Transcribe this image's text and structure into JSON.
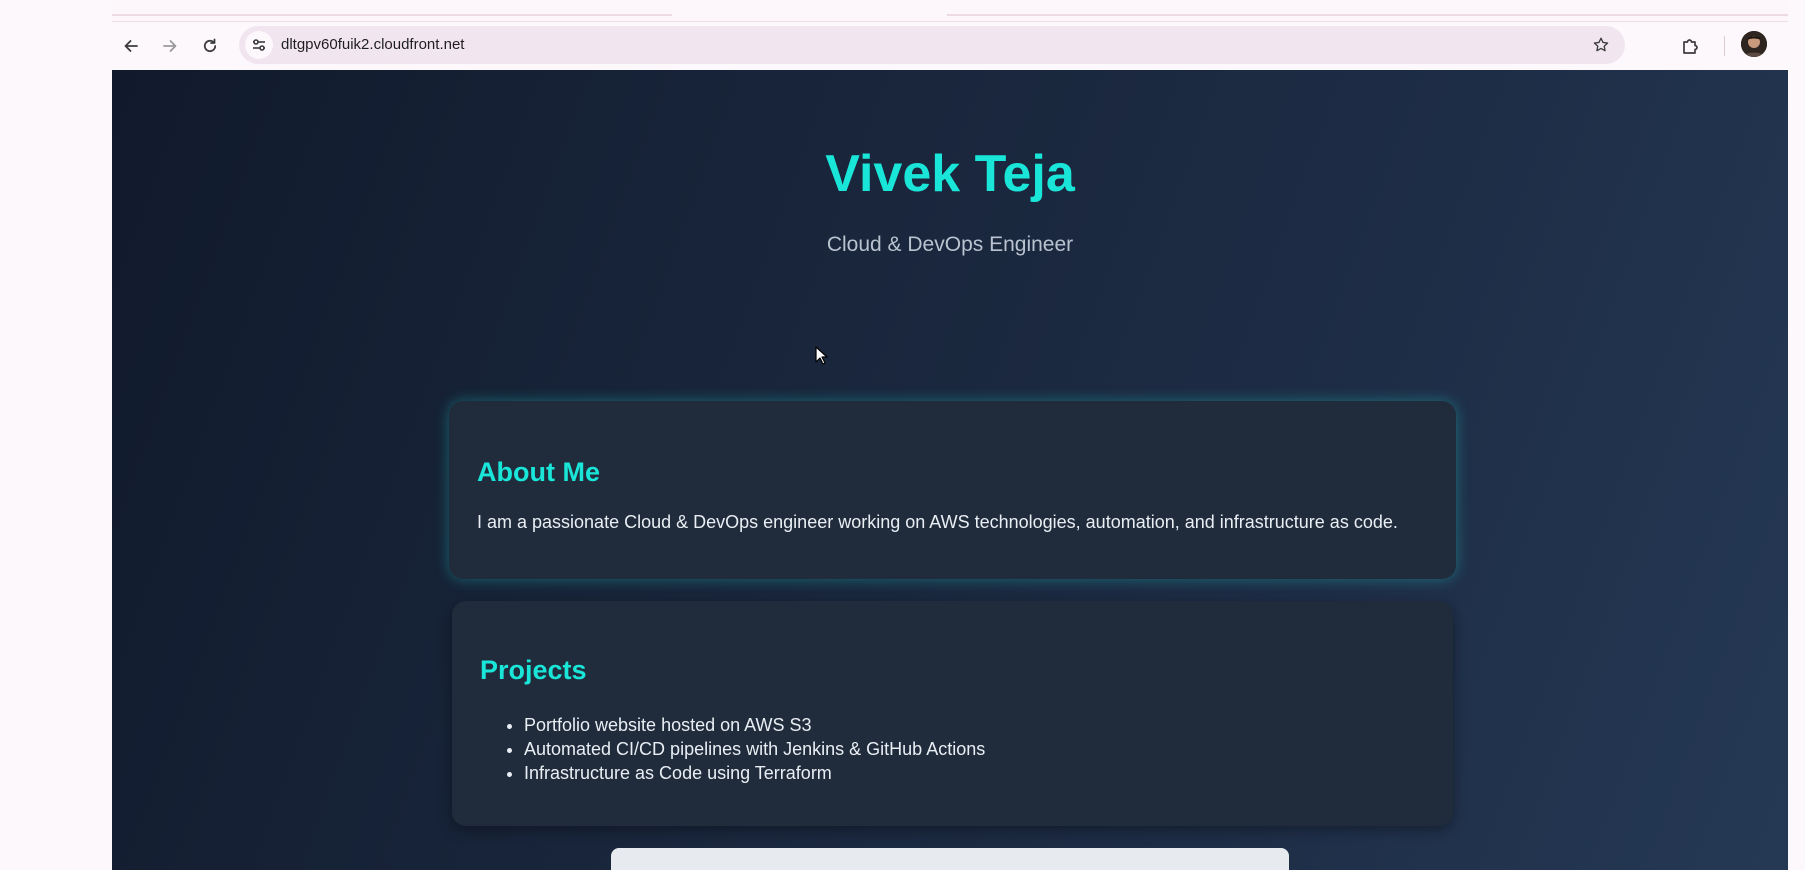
{
  "browser": {
    "url": "dltgpv60fuik2.cloudfront.net",
    "icons": {
      "back": "arrow-left-icon",
      "forward": "arrow-right-icon",
      "reload": "reload-icon",
      "site_info": "tune-icon",
      "bookmark": "star-icon",
      "extensions": "puzzle-icon",
      "profile": "avatar-icon"
    }
  },
  "hero": {
    "name": "Vivek Teja",
    "subtitle": "Cloud & DevOps Engineer"
  },
  "about": {
    "heading": "About Me",
    "text": "I am a passionate Cloud & DevOps engineer working on AWS technologies, automation, and infrastructure as code."
  },
  "projects": {
    "heading": "Projects",
    "items": [
      "Portfolio website hosted on AWS S3",
      "Automated CI/CD pipelines with Jenkins & GitHub Actions",
      "Infrastructure as Code using Terraform"
    ]
  },
  "colors": {
    "accent": "#19e6d9",
    "card": "#202c3b",
    "background_dark": "#111a2c",
    "background_light": "#253955"
  }
}
